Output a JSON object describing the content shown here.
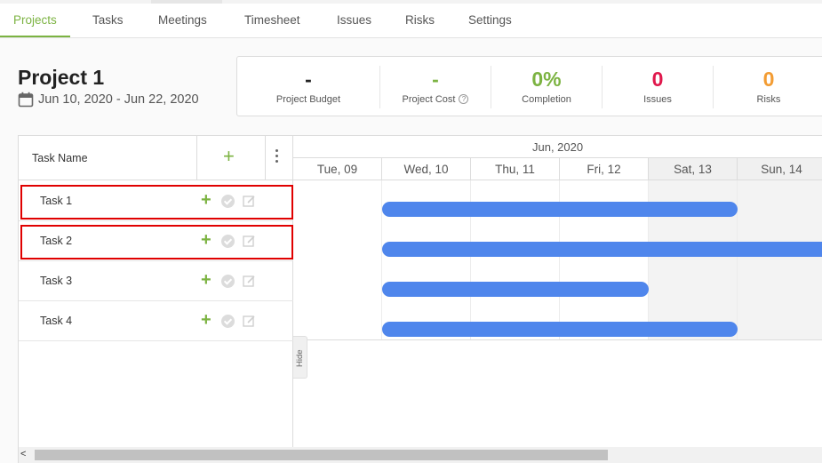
{
  "tabs": [
    {
      "label": "Projects",
      "active": true
    },
    {
      "label": "Tasks"
    },
    {
      "label": "Meetings"
    },
    {
      "label": "Timesheet"
    },
    {
      "label": "Issues"
    },
    {
      "label": "Risks"
    },
    {
      "label": "Settings"
    }
  ],
  "project": {
    "title": "Project 1",
    "dates": "Jun 10, 2020 - Jun 22, 2020",
    "calendar_icon": "calendar-icon"
  },
  "stats": [
    {
      "value": "-",
      "label": "Project Budget",
      "color": "#222222"
    },
    {
      "value": "-",
      "label": "Project Cost",
      "color": "#7cb342",
      "help_icon": "?"
    },
    {
      "value": "0%",
      "label": "Completion",
      "color": "#7cb342"
    },
    {
      "value": "0",
      "label": "Issues",
      "color": "#e0184c"
    },
    {
      "value": "0",
      "label": "Risks",
      "color": "#f39c33"
    }
  ],
  "grid": {
    "column_task_name": "Task Name",
    "add_symbol": "+",
    "hide_label": "Hide"
  },
  "tasks": [
    {
      "name": "Task 1",
      "highlighted": true,
      "start": "Wed, 10",
      "end": "Sat, 13"
    },
    {
      "name": "Task 2",
      "highlighted": true,
      "start": "Wed, 10",
      "end": "beyond Sun, 14"
    },
    {
      "name": "Task 3",
      "highlighted": false,
      "start": "Wed, 10",
      "end": "Fri, 12"
    },
    {
      "name": "Task 4",
      "highlighted": false,
      "start": "Wed, 10",
      "end": "Sat, 13"
    }
  ],
  "timeline": {
    "month": "Jun, 2020",
    "days": [
      {
        "label": "Tue, 09",
        "weekend": false
      },
      {
        "label": "Wed, 10",
        "weekend": false
      },
      {
        "label": "Thu, 11",
        "weekend": false
      },
      {
        "label": "Fri, 12",
        "weekend": false
      },
      {
        "label": "Sat, 13",
        "weekend": true
      },
      {
        "label": "Sun, 14",
        "weekend": true
      }
    ]
  },
  "colors": {
    "accent": "#7cb342",
    "bar": "#4f86ec",
    "highlight": "#e00000"
  },
  "scrollbar": {
    "left_arrow": "<"
  }
}
